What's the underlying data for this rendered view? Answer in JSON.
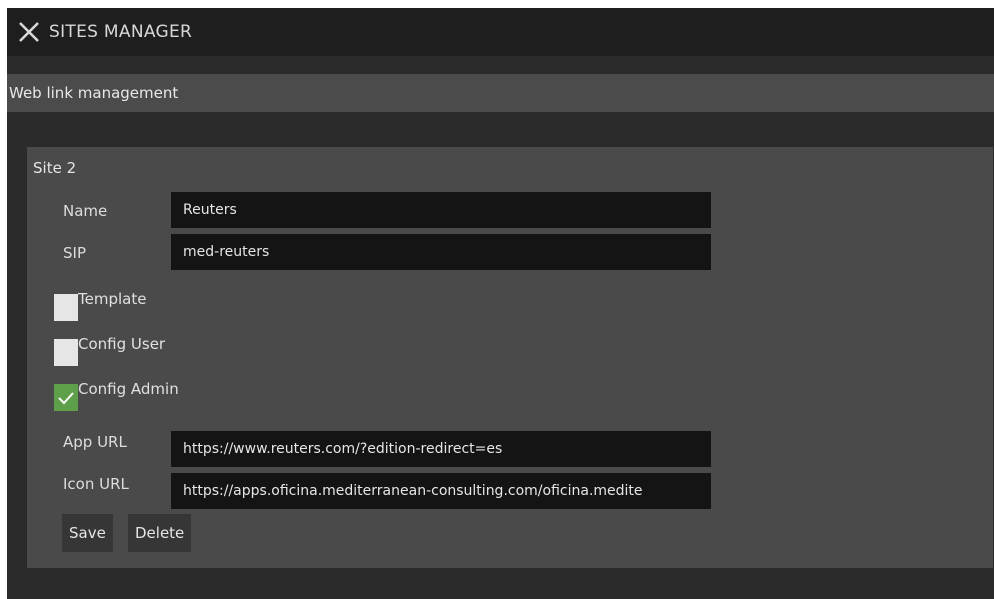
{
  "window": {
    "title": "SITES MANAGER"
  },
  "subheader": {
    "label": "Web link management"
  },
  "site": {
    "title": "Site 2",
    "name": {
      "label": "Name",
      "value": "Reuters"
    },
    "sip": {
      "label": "SIP",
      "value": "med-reuters"
    },
    "options": [
      {
        "label": "Template",
        "checked": false
      },
      {
        "label": "Config User",
        "checked": false
      },
      {
        "label": "Config Admin",
        "checked": true
      }
    ],
    "app_url": {
      "label": "App URL",
      "value": "https://www.reuters.com/?edition-redirect=es"
    },
    "icon_url": {
      "label": "Icon URL",
      "value": "https://apps.oficina.mediterranean-consulting.com/oficina.medite"
    },
    "buttons": {
      "save": "Save",
      "delete": "Delete"
    }
  },
  "colors": {
    "checked": "#5ea04a",
    "unchecked": "#e6e6e6",
    "panel": "#4a4a4a",
    "input": "#141414"
  }
}
